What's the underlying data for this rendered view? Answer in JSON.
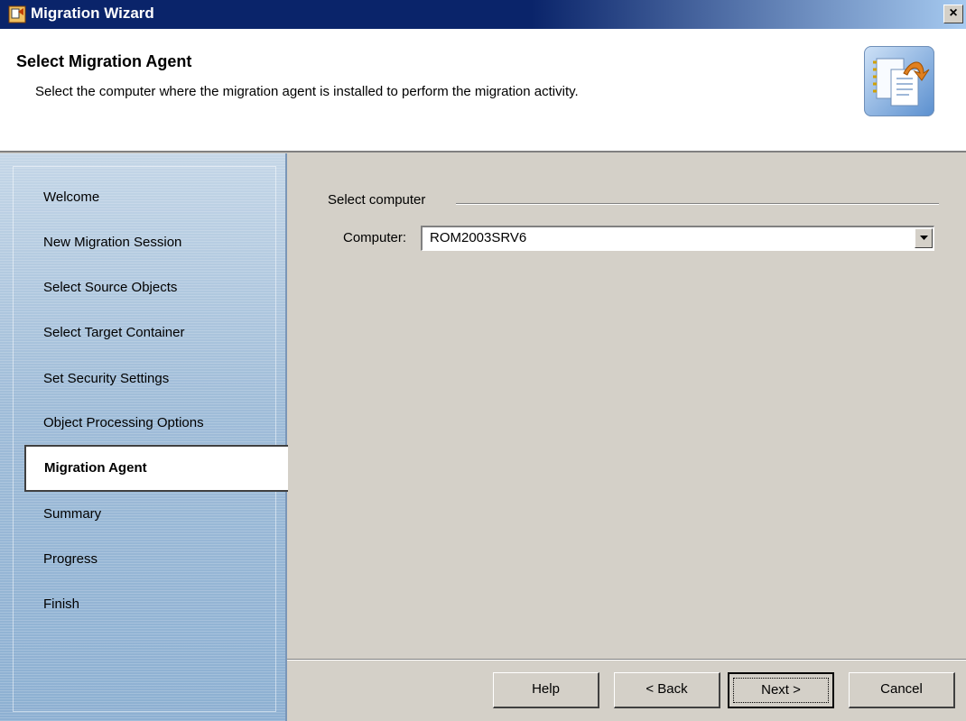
{
  "window": {
    "title": "Migration Wizard",
    "close_glyph": "×"
  },
  "header": {
    "title": "Select Migration Agent",
    "subtitle": "Select the computer where the migration agent is installed to perform the migration activity.",
    "icon": "wizard-document-icon"
  },
  "sidebar": {
    "items": [
      {
        "label": "Welcome"
      },
      {
        "label": "New Migration Session"
      },
      {
        "label": "Select Source Objects"
      },
      {
        "label": "Select Target Container"
      },
      {
        "label": "Set Security Settings"
      },
      {
        "label": "Object Processing Options"
      },
      {
        "label": "Migration Agent",
        "active": true
      },
      {
        "label": "Summary"
      },
      {
        "label": "Progress"
      },
      {
        "label": "Finish"
      }
    ]
  },
  "content": {
    "group_label": "Select computer",
    "computer_label": "Computer:",
    "computer_value": "ROM2003SRV6"
  },
  "buttons": {
    "help": "Help",
    "back": "< Back",
    "next": "Next >",
    "cancel": "Cancel"
  },
  "colors": {
    "titlebar": "#0a246a",
    "window_bg": "#d4d0c8",
    "sidebar_bg": "#9fbcd8"
  }
}
